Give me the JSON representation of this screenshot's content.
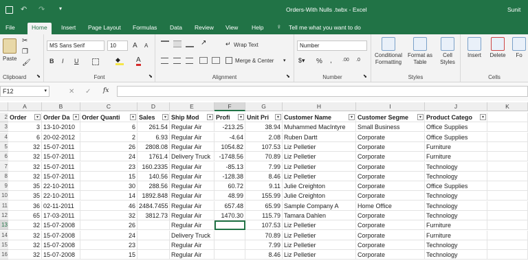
{
  "title_bar": {
    "doc_title": "Orders-With Nulls .twbx - Excel",
    "user": "Sunit"
  },
  "tabs": [
    "File",
    "Home",
    "Insert",
    "Page Layout",
    "Formulas",
    "Data",
    "Review",
    "View",
    "Help"
  ],
  "tell_me": "Tell me what you want to do",
  "ribbon": {
    "clipboard": {
      "paste": "Paste",
      "label": "Clipboard"
    },
    "font": {
      "name": "MS Sans Serif",
      "size": "10",
      "grow": "A",
      "shrink": "A",
      "bold": "B",
      "italic": "I",
      "underline": "U",
      "font_color": "A",
      "label": "Font"
    },
    "alignment": {
      "wrap": "Wrap Text",
      "merge": "Merge & Center",
      "label": "Alignment"
    },
    "number": {
      "format": "Number",
      "percent": "%",
      "comma": ",",
      "inc": ".00",
      "label": "Number"
    },
    "styles": {
      "cond": "Conditional",
      "cond2": "Formatting",
      "fmt": "Format as",
      "fmt2": "Table",
      "cell": "Cell",
      "cell2": "Styles",
      "label": "Styles"
    },
    "cells": {
      "insert": "Insert",
      "delete": "Delete",
      "format": "Fo",
      "label": "Cells"
    }
  },
  "formula_bar": {
    "name_box": "F12",
    "fx": "fx",
    "value": ""
  },
  "columns": [
    "A",
    "B",
    "C",
    "D",
    "E",
    "F",
    "G",
    "H",
    "I",
    "J",
    "K"
  ],
  "headers": [
    "Order",
    "Order Da",
    "Order Quanti",
    "Sales",
    "Ship Mod",
    "Profi",
    "Unit Pri",
    "Customer Name",
    "Customer Segme",
    "Product Catego"
  ],
  "row_numbers": [
    "2",
    "3",
    "4",
    "5",
    "6",
    "7",
    "8",
    "9",
    "10",
    "11",
    "12",
    "13",
    "14",
    "15",
    "16"
  ],
  "rows": [
    [
      "3",
      "13-10-2010",
      "6",
      "261.54",
      "Regular Air",
      "-213.25",
      "38.94",
      "Muhammed MacIntyre",
      "Small Business",
      "Office Supplies"
    ],
    [
      "6",
      "20-02-2012",
      "2",
      "6.93",
      "Regular Air",
      "-4.64",
      "2.08",
      "Ruben Dartt",
      "Corporate",
      "Office Supplies"
    ],
    [
      "32",
      "15-07-2011",
      "26",
      "2808.08",
      "Regular Air",
      "1054.82",
      "107.53",
      "Liz Pelletier",
      "Corporate",
      "Furniture"
    ],
    [
      "32",
      "15-07-2011",
      "24",
      "1761.4",
      "Delivery Truck",
      "-1748.56",
      "70.89",
      "Liz Pelletier",
      "Corporate",
      "Furniture"
    ],
    [
      "32",
      "15-07-2011",
      "23",
      "160.2335",
      "Regular Air",
      "-85.13",
      "7.99",
      "Liz Pelletier",
      "Corporate",
      "Technology"
    ],
    [
      "32",
      "15-07-2011",
      "15",
      "140.56",
      "Regular Air",
      "-128.38",
      "8.46",
      "Liz Pelletier",
      "Corporate",
      "Technology"
    ],
    [
      "35",
      "22-10-2011",
      "30",
      "288.56",
      "Regular Air",
      "60.72",
      "9.11",
      "Julie Creighton",
      "Corporate",
      "Office Supplies"
    ],
    [
      "35",
      "22-10-2011",
      "14",
      "1892.848",
      "Regular Air",
      "48.99",
      "155.99",
      "Julie Creighton",
      "Corporate",
      "Technology"
    ],
    [
      "36",
      "02-11-2011",
      "46",
      "2484.7455",
      "Regular Air",
      "657.48",
      "65.99",
      "Sample Company A",
      "Home Office",
      "Technology"
    ],
    [
      "65",
      "17-03-2011",
      "32",
      "3812.73",
      "Regular Air",
      "1470.30",
      "115.79",
      "Tamara Dahlen",
      "Corporate",
      "Technology"
    ],
    [
      "32",
      "15-07-2008",
      "26",
      "",
      "Regular Air",
      "",
      "107.53",
      "Liz Pelletier",
      "Corporate",
      "Furniture"
    ],
    [
      "32",
      "15-07-2008",
      "24",
      "",
      "Delivery Truck",
      "",
      "70.89",
      "Liz Pelletier",
      "Corporate",
      "Furniture"
    ],
    [
      "32",
      "15-07-2008",
      "23",
      "",
      "Regular Air",
      "",
      "7.99",
      "Liz Pelletier",
      "Corporate",
      "Technology"
    ],
    [
      "32",
      "15-07-2008",
      "15",
      "",
      "Regular Air",
      "",
      "8.46",
      "Liz Pelletier",
      "Corporate",
      "Technology"
    ]
  ]
}
